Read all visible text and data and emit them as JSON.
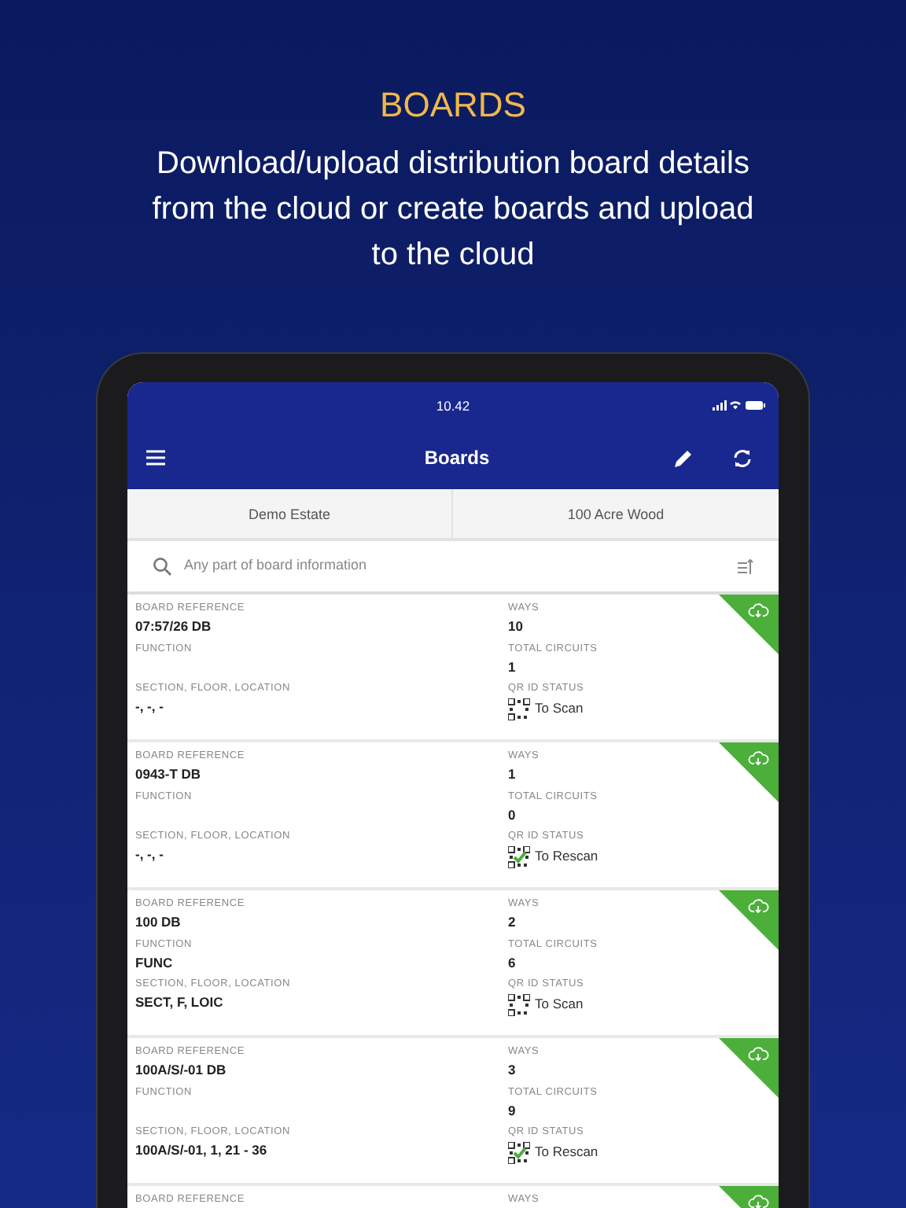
{
  "promo": {
    "title": "BOARDS",
    "subtitle": "Download/upload distribution board details from the cloud or create boards and upload to the cloud"
  },
  "status_bar": {
    "time": "10.42"
  },
  "nav_bar": {
    "title": "Boards"
  },
  "tabs": [
    {
      "label": "Demo Estate"
    },
    {
      "label": "100 Acre Wood"
    }
  ],
  "search": {
    "placeholder": "Any part of board information"
  },
  "boards": [
    {
      "left_labels": [
        "BOARD REFERENCE",
        "FUNCTION",
        "SECTION, FLOOR, LOCATION"
      ],
      "right_labels": [
        "WAYS",
        "TOTAL CIRCUITS",
        "QR ID STATUS"
      ],
      "reference": "07:57/26 DB",
      "location": "-, -, -",
      "ways": "10",
      "total_circuits": "1",
      "qr_status": "To Scan",
      "qr_checked": false,
      "synced": true
    },
    {
      "left_labels": [
        "BOARD REFERENCE",
        "FUNCTION",
        "SECTION, FLOOR, LOCATION"
      ],
      "right_labels": [
        "WAYS",
        "TOTAL CIRCUITS",
        "QR ID STATUS"
      ],
      "reference": "0943-T DB",
      "location": "-, -, -",
      "ways": "1",
      "total_circuits": "0",
      "qr_status": "To Rescan",
      "qr_checked": true,
      "synced": true
    },
    {
      "left_labels": [
        "BOARD REFERENCE",
        "FUNCTION",
        "SECTION, FLOOR, LOCATION"
      ],
      "right_labels": [
        "WAYS",
        "TOTAL CIRCUITS",
        "QR ID STATUS"
      ],
      "reference": "100 DB",
      "function": "FUNC",
      "location": "SECT, F, LOIC",
      "ways": "2",
      "total_circuits": "6",
      "qr_status": "To Scan",
      "qr_checked": false,
      "synced": true
    },
    {
      "left_labels": [
        "BOARD REFERENCE",
        "FUNCTION",
        "SECTION, FLOOR, LOCATION"
      ],
      "right_labels": [
        "WAYS",
        "TOTAL CIRCUITS",
        "QR ID STATUS"
      ],
      "reference": "100A/S/-01 DB",
      "location": "100A/S/-01, 1, 21 - 36",
      "ways": "3",
      "total_circuits": "9",
      "qr_status": "To Rescan",
      "qr_checked": true,
      "synced": true
    },
    {
      "left_labels": [
        "BOARD REFERENCE"
      ],
      "right_labels": [
        "WAYS"
      ],
      "synced": true
    }
  ]
}
